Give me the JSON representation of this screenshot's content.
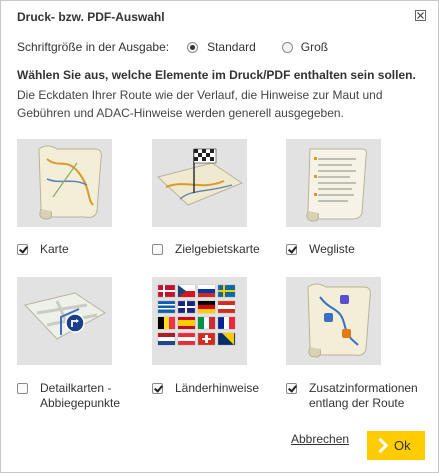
{
  "dialog": {
    "title": "Druck- bzw. PDF-Auswahl",
    "close_icon": "close-icon"
  },
  "font_size": {
    "label": "Schriftgröße in der Ausgabe:",
    "options": [
      {
        "label": "Standard",
        "selected": true
      },
      {
        "label": "Groß",
        "selected": false
      }
    ]
  },
  "heading": "Wählen Sie aus, welche Elemente im Druck/PDF enthalten sein sollen.",
  "description": "Die Eckdaten Ihrer Route wie der Verlauf, die Hinweise zur Maut und Gebühren und ADAC-Hinweise werden generell ausgegeben.",
  "elements": [
    {
      "label": "Karte",
      "checked": true,
      "icon": "map-scroll-icon"
    },
    {
      "label": "Zielgebietskarte",
      "checked": false,
      "icon": "destination-flag-map-icon"
    },
    {
      "label": "Wegliste",
      "checked": true,
      "icon": "route-list-scroll-icon"
    },
    {
      "label": "Detailkarten -",
      "label2": "Abbiegepunkte",
      "checked": false,
      "icon": "turn-point-map-icon"
    },
    {
      "label": "Länderhinweise",
      "checked": true,
      "icon": "country-flags-icon"
    },
    {
      "label": "Zusatzinformationen",
      "label2": "entlang der Route",
      "checked": true,
      "icon": "info-route-scroll-icon"
    }
  ],
  "actions": {
    "cancel_label": "Abbrechen",
    "ok_label": "Ok"
  },
  "colors": {
    "accent": "#ffcc00",
    "tile_background": "#e2e2e2"
  }
}
